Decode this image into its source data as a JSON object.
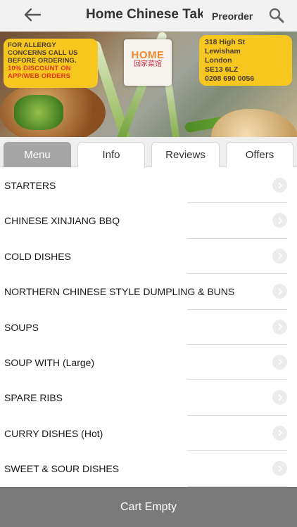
{
  "header": {
    "title": "Home Chinese Takeaway",
    "preorder_label": "Preorder",
    "back_icon": "arrow-left-icon",
    "search_icon": "search-icon"
  },
  "banner": {
    "promo_lines": [
      "FOR ALLERGY",
      "CONCERNS CALL US",
      "BEFORE ORDERING."
    ],
    "discount_lines": [
      "10% DISCOUNT ON",
      "APP/WEB ORDERS"
    ],
    "logo_text": "HOME",
    "logo_subtext": "回家菜馆",
    "address_lines": [
      "318 High St",
      "Lewisham",
      "London",
      "SE13 6LZ",
      "0208 690 0056"
    ]
  },
  "tabs": [
    {
      "label": "Menu",
      "active": true
    },
    {
      "label": "Info",
      "active": false
    },
    {
      "label": "Reviews",
      "active": false
    },
    {
      "label": "Offers",
      "active": false
    }
  ],
  "categories": [
    "STARTERS",
    "CHINESE XINJIANG BBQ",
    "COLD DISHES",
    "NORTHERN CHINESE STYLE DUMPLING & BUNS",
    "SOUPS",
    "SOUP WITH (Large)",
    "SPARE RIBS",
    "CURRY DISHES (Hot)",
    "SWEET & SOUR DISHES"
  ],
  "cart": {
    "label": "Cart Empty"
  },
  "colors": {
    "accent_yellow": "#f6c81f",
    "discount_red": "#e0361c",
    "active_tab": "#a6a6a6",
    "cart_bar": "#7a7a7a"
  }
}
